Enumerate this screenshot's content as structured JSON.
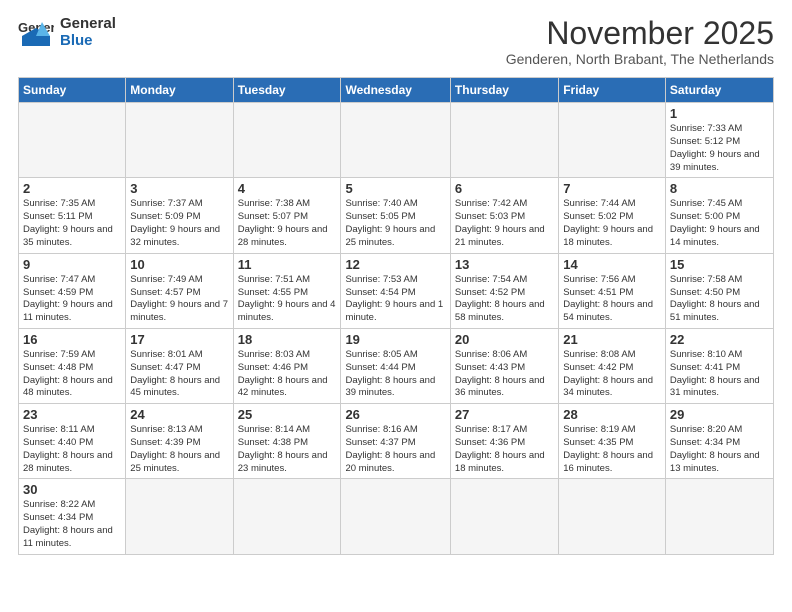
{
  "logo": {
    "text_general": "General",
    "text_blue": "Blue"
  },
  "title": "November 2025",
  "subtitle": "Genderen, North Brabant, The Netherlands",
  "weekdays": [
    "Sunday",
    "Monday",
    "Tuesday",
    "Wednesday",
    "Thursday",
    "Friday",
    "Saturday"
  ],
  "weeks": [
    [
      {
        "day": "",
        "info": ""
      },
      {
        "day": "",
        "info": ""
      },
      {
        "day": "",
        "info": ""
      },
      {
        "day": "",
        "info": ""
      },
      {
        "day": "",
        "info": ""
      },
      {
        "day": "",
        "info": ""
      },
      {
        "day": "1",
        "info": "Sunrise: 7:33 AM\nSunset: 5:12 PM\nDaylight: 9 hours and 39 minutes."
      }
    ],
    [
      {
        "day": "2",
        "info": "Sunrise: 7:35 AM\nSunset: 5:11 PM\nDaylight: 9 hours and 35 minutes."
      },
      {
        "day": "3",
        "info": "Sunrise: 7:37 AM\nSunset: 5:09 PM\nDaylight: 9 hours and 32 minutes."
      },
      {
        "day": "4",
        "info": "Sunrise: 7:38 AM\nSunset: 5:07 PM\nDaylight: 9 hours and 28 minutes."
      },
      {
        "day": "5",
        "info": "Sunrise: 7:40 AM\nSunset: 5:05 PM\nDaylight: 9 hours and 25 minutes."
      },
      {
        "day": "6",
        "info": "Sunrise: 7:42 AM\nSunset: 5:03 PM\nDaylight: 9 hours and 21 minutes."
      },
      {
        "day": "7",
        "info": "Sunrise: 7:44 AM\nSunset: 5:02 PM\nDaylight: 9 hours and 18 minutes."
      },
      {
        "day": "8",
        "info": "Sunrise: 7:45 AM\nSunset: 5:00 PM\nDaylight: 9 hours and 14 minutes."
      }
    ],
    [
      {
        "day": "9",
        "info": "Sunrise: 7:47 AM\nSunset: 4:59 PM\nDaylight: 9 hours and 11 minutes."
      },
      {
        "day": "10",
        "info": "Sunrise: 7:49 AM\nSunset: 4:57 PM\nDaylight: 9 hours and 7 minutes."
      },
      {
        "day": "11",
        "info": "Sunrise: 7:51 AM\nSunset: 4:55 PM\nDaylight: 9 hours and 4 minutes."
      },
      {
        "day": "12",
        "info": "Sunrise: 7:53 AM\nSunset: 4:54 PM\nDaylight: 9 hours and 1 minute."
      },
      {
        "day": "13",
        "info": "Sunrise: 7:54 AM\nSunset: 4:52 PM\nDaylight: 8 hours and 58 minutes."
      },
      {
        "day": "14",
        "info": "Sunrise: 7:56 AM\nSunset: 4:51 PM\nDaylight: 8 hours and 54 minutes."
      },
      {
        "day": "15",
        "info": "Sunrise: 7:58 AM\nSunset: 4:50 PM\nDaylight: 8 hours and 51 minutes."
      }
    ],
    [
      {
        "day": "16",
        "info": "Sunrise: 7:59 AM\nSunset: 4:48 PM\nDaylight: 8 hours and 48 minutes."
      },
      {
        "day": "17",
        "info": "Sunrise: 8:01 AM\nSunset: 4:47 PM\nDaylight: 8 hours and 45 minutes."
      },
      {
        "day": "18",
        "info": "Sunrise: 8:03 AM\nSunset: 4:46 PM\nDaylight: 8 hours and 42 minutes."
      },
      {
        "day": "19",
        "info": "Sunrise: 8:05 AM\nSunset: 4:44 PM\nDaylight: 8 hours and 39 minutes."
      },
      {
        "day": "20",
        "info": "Sunrise: 8:06 AM\nSunset: 4:43 PM\nDaylight: 8 hours and 36 minutes."
      },
      {
        "day": "21",
        "info": "Sunrise: 8:08 AM\nSunset: 4:42 PM\nDaylight: 8 hours and 34 minutes."
      },
      {
        "day": "22",
        "info": "Sunrise: 8:10 AM\nSunset: 4:41 PM\nDaylight: 8 hours and 31 minutes."
      }
    ],
    [
      {
        "day": "23",
        "info": "Sunrise: 8:11 AM\nSunset: 4:40 PM\nDaylight: 8 hours and 28 minutes."
      },
      {
        "day": "24",
        "info": "Sunrise: 8:13 AM\nSunset: 4:39 PM\nDaylight: 8 hours and 25 minutes."
      },
      {
        "day": "25",
        "info": "Sunrise: 8:14 AM\nSunset: 4:38 PM\nDaylight: 8 hours and 23 minutes."
      },
      {
        "day": "26",
        "info": "Sunrise: 8:16 AM\nSunset: 4:37 PM\nDaylight: 8 hours and 20 minutes."
      },
      {
        "day": "27",
        "info": "Sunrise: 8:17 AM\nSunset: 4:36 PM\nDaylight: 8 hours and 18 minutes."
      },
      {
        "day": "28",
        "info": "Sunrise: 8:19 AM\nSunset: 4:35 PM\nDaylight: 8 hours and 16 minutes."
      },
      {
        "day": "29",
        "info": "Sunrise: 8:20 AM\nSunset: 4:34 PM\nDaylight: 8 hours and 13 minutes."
      }
    ],
    [
      {
        "day": "30",
        "info": "Sunrise: 8:22 AM\nSunset: 4:34 PM\nDaylight: 8 hours and 11 minutes."
      },
      {
        "day": "",
        "info": ""
      },
      {
        "day": "",
        "info": ""
      },
      {
        "day": "",
        "info": ""
      },
      {
        "day": "",
        "info": ""
      },
      {
        "day": "",
        "info": ""
      },
      {
        "day": "",
        "info": ""
      }
    ]
  ]
}
